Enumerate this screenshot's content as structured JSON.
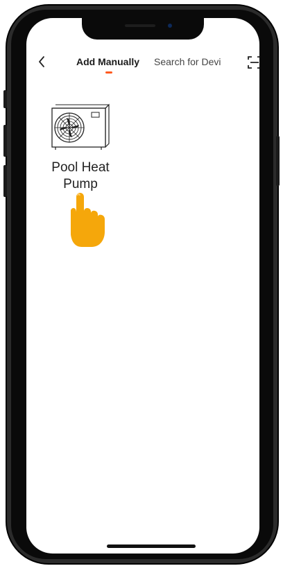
{
  "header": {
    "tabs": [
      {
        "label": "Add Manually",
        "active": true
      },
      {
        "label": "Search for Devi",
        "active": false
      }
    ],
    "back_icon": "chevron-left-icon",
    "scan_icon": "scan-frame-icon"
  },
  "devices": [
    {
      "label_line1": "Pool Heat",
      "label_line2": "Pump",
      "icon": "heat-pump-icon"
    }
  ],
  "colors": {
    "tab_indicator": "#ff5a1f",
    "pointer": "#f5a70b"
  }
}
